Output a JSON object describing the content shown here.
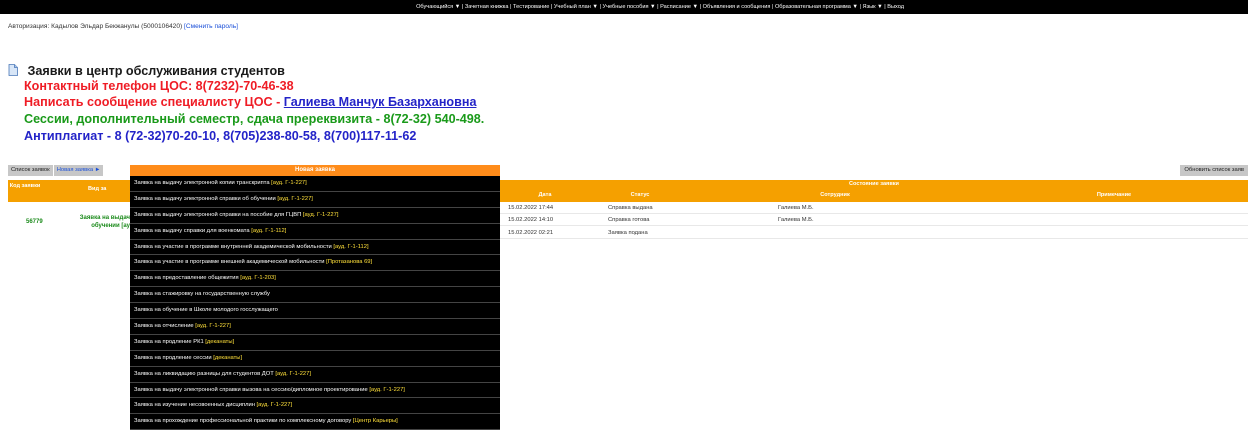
{
  "topbar": {
    "menu": "Обучающийся ▼ | Зачетная книжка | Тестирование | Учебный план ▼ | Учебные пособия ▼ | Расписание ▼ | Объявления и сообщения | Образовательная программа ▼ | Язык ▼ | Выход"
  },
  "auth": {
    "label": "Авторизация:",
    "user": "Кадылов Эльдар Бекжанулы (5000106420)",
    "change_password": "[Сменить пароль]"
  },
  "page": {
    "title": "Заявки в центр обслуживания студентов",
    "phone": "Контактный телефон ЦОС: 8(7232)-70-46-38",
    "message_prefix": "Написать сообщение специалисту ЦОС - ",
    "specialist": "Галиева Манчук Базархановна",
    "sessions": "Сессии, дополнительный семестр,  сдача пререквизита - 8(72-32) 540-498.",
    "antiplagiat": "Антиплагиат - 8 (72-32)70-20-10, 8(705)238-80-58, 8(700)117-11-62"
  },
  "tabs": {
    "list": "Список заявок",
    "new": "Новая заявка ►"
  },
  "refresh_button": "Обновить список заяв",
  "table": {
    "code_header": "Код заявки",
    "type_header": "Вид за",
    "state_header": "Состояние заявки",
    "date_header": "Дата",
    "status_header": "Статус",
    "staff_header": "Сотрудник",
    "note_header": "Примечание",
    "request_code": "56779",
    "request_type": "Заявка на выдач обучении [ау",
    "history": [
      {
        "date": "15.02.2022 17:44",
        "status": "Справка выдана",
        "staff": "Галиева М.Б."
      },
      {
        "date": "15.02.2022 14:10",
        "status": "Справка готова",
        "staff": "Галиева М.Б."
      },
      {
        "date": "15.02.2022 02:21",
        "status": "Заявка подана",
        "staff": ""
      }
    ]
  },
  "menu": {
    "header": "Новая заявка",
    "items": [
      {
        "text": "Заявка на выдачу электронной копии транскрипта ",
        "loc": "[ауд. Г-1-227]"
      },
      {
        "text": "Заявка на выдачу электронной справки об обучении ",
        "loc": "[ауд. Г-1-227]"
      },
      {
        "text": "Заявка на выдачу электронной справки на пособие для ГЦВП ",
        "loc": "[ауд. Г-1-227]"
      },
      {
        "text": "Заявка на выдачу справки для военкомата ",
        "loc": "[ауд. Г-1-112]"
      },
      {
        "text": "Заявка на участие в программе внутренней академической мобильности ",
        "loc": "[ауд. Г-1-112]"
      },
      {
        "text": "Заявка на участие в программе внешней академической мобильности ",
        "loc": "[Протазанова 69]"
      },
      {
        "text": "Заявка на предоставление общежития ",
        "loc": "[ауд. Г-1-203]"
      },
      {
        "text": "Заявка на стажировку на государственную службу",
        "loc": ""
      },
      {
        "text": "Заявка на обучение в Школе молодого госслужащего",
        "loc": ""
      },
      {
        "text": "Заявка на отчисление ",
        "loc": "[ауд. Г-1-227]"
      },
      {
        "text": "Заявка на продление РК1 ",
        "loc": "[деканаты]"
      },
      {
        "text": "Заявка на продление сессии ",
        "loc": "[деканаты]"
      },
      {
        "text": "Заявка на ликвидацию разницы для студентов ДОТ ",
        "loc": "[ауд. Г-1-227]"
      },
      {
        "text": "Заявка на выдачу электронной справки вызова на сессию/дипломное проектирование ",
        "loc": "[ауд. Г-1-227]"
      },
      {
        "text": "Заявка на изучение несовоенных дисциплин ",
        "loc": "[ауд. Г-1-227]"
      },
      {
        "text": "Заявка на прохождение профессиональной практики по комплексному договору ",
        "loc": "[Центр Карьеры]"
      }
    ]
  },
  "colors": {
    "orange": "#f5a000",
    "menu_header": "#ff8c1a",
    "red": "#ef1c25",
    "green": "#1a9a1a",
    "blue": "#2323c8"
  }
}
